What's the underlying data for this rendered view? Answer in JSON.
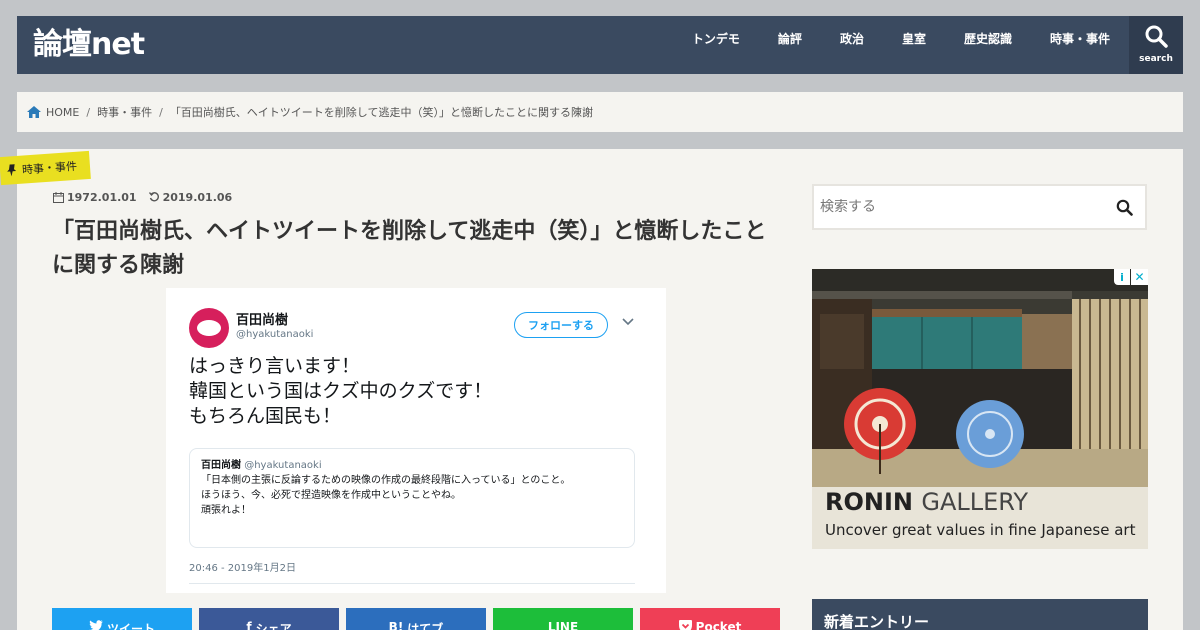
{
  "header": {
    "logo": "論壇net",
    "nav": [
      "トンデモ",
      "論評",
      "政治",
      "皇室",
      "歴史認識",
      "時事・事件"
    ],
    "search_label": "search"
  },
  "breadcrumb": {
    "home": "HOME",
    "category": "時事・事件",
    "current": "「百田尚樹氏、ヘイトツイートを削除して逃走中（笑）」と憶断したことに関する陳謝"
  },
  "article": {
    "category_tag": "時事・事件",
    "published": "1972.01.01",
    "updated": "2019.01.06",
    "title": "「百田尚樹氏、ヘイトツイートを削除して逃走中（笑）」と憶断したことに関する陳謝"
  },
  "tweet": {
    "name": "百田尚樹",
    "handle": "@hyakutanaoki",
    "follow_label": "フォローする",
    "lines": [
      "はっきり言います！",
      "韓国という国はクズ中のクズです！",
      "もちろん国民も！"
    ],
    "quote": {
      "name": "百田尚樹",
      "handle": "@hyakutanaoki",
      "lines": [
        "「日本側の主張に反論するための映像の作成の最終段階に入っている」とのこと。",
        "ほうほう、今、必死で捏造映像を作成中ということやね。",
        "頑張れよ！"
      ]
    },
    "time": "20:46 - 2019年1月2日"
  },
  "share": {
    "twitter": "ツイート",
    "facebook": "シェア",
    "hatena": "はてブ",
    "line": "LINE",
    "pocket": "Pocket"
  },
  "sidebar": {
    "search_placeholder": "検索する",
    "ad_title_bold": "RONIN",
    "ad_title_light": "GALLERY",
    "ad_subtitle": "Uncover great values in fine Japanese art",
    "new_entries": "新着エントリー"
  },
  "colors": {
    "header_bg": "#3a4a60",
    "tag_yellow": "#e9df20",
    "twitter": "#1da1f2",
    "facebook": "#3b5998",
    "hatena": "#2c6ebd",
    "line": "#1dbe3a",
    "pocket": "#ef3f56"
  }
}
